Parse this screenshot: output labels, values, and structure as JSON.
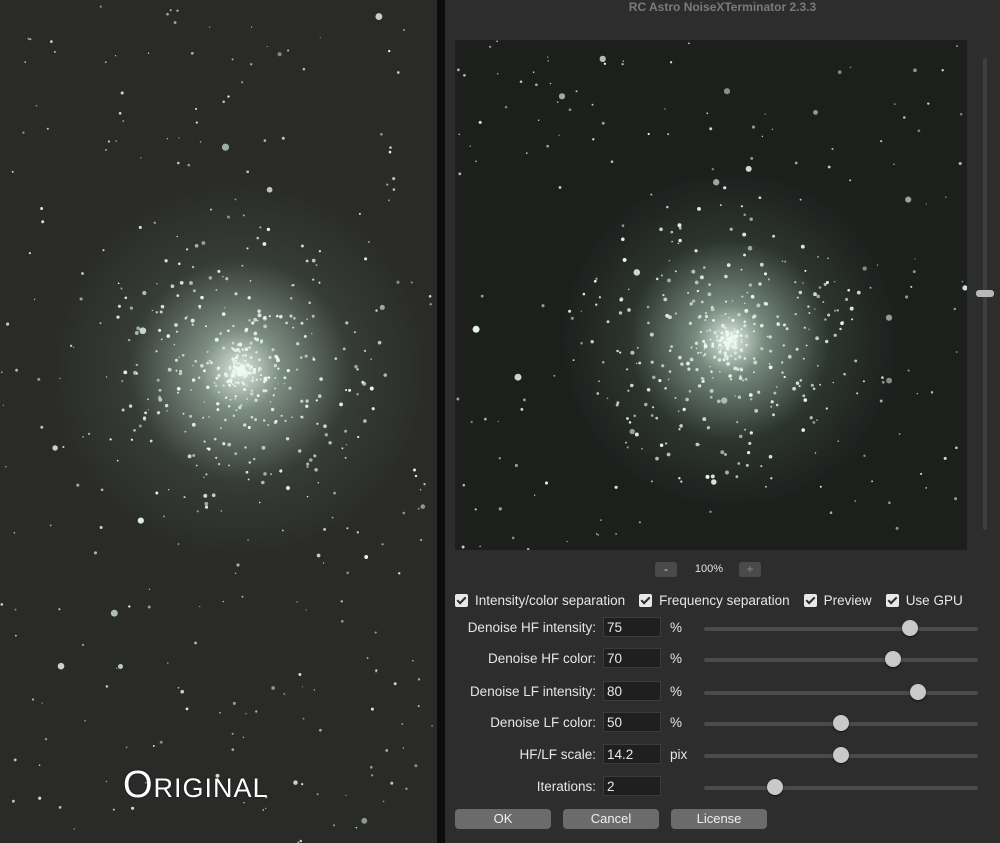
{
  "original": {
    "label": "Original"
  },
  "window": {
    "title": "RC Astro NoiseXTerminator 2.3.3"
  },
  "preview": {
    "zoom_out_label": "-",
    "zoom_level": "100%",
    "zoom_in_label": "+",
    "scroll_position": 0.5
  },
  "options": [
    {
      "label": "Intensity/color separation",
      "checked": true
    },
    {
      "label": "Frequency separation",
      "checked": true
    },
    {
      "label": "Preview",
      "checked": true
    },
    {
      "label": "Use GPU",
      "checked": true
    }
  ],
  "params": [
    {
      "label": "Denoise HF intensity:",
      "value": "75",
      "unit": "%",
      "slider": 0.75
    },
    {
      "label": "Denoise HF color:",
      "value": "70",
      "unit": "%",
      "slider": 0.69
    },
    {
      "label": "Denoise LF intensity:",
      "value": "80",
      "unit": "%",
      "slider": 0.78
    },
    {
      "label": "Denoise LF color:",
      "value": "50",
      "unit": "%",
      "slider": 0.5
    },
    {
      "label": "HF/LF scale:",
      "value": "14.2",
      "unit": "pix",
      "slider": 0.5
    },
    {
      "label": "Iterations:",
      "value": "2",
      "unit": "",
      "slider": 0.26
    }
  ],
  "buttons": {
    "ok": "OK",
    "cancel": "Cancel",
    "license": "License"
  }
}
